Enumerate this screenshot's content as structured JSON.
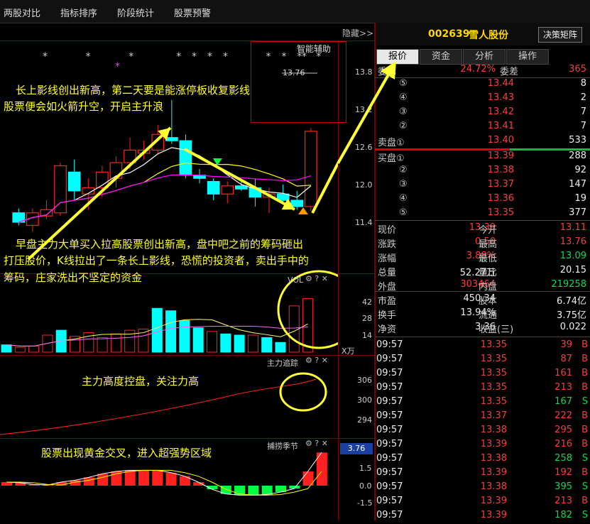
{
  "top_menu": [
    "两股对比",
    "指标排序",
    "阶段统计",
    "股票预警"
  ],
  "hide_label": "隐藏>>",
  "stock": {
    "code": "002639",
    "name": "雪人股份",
    "decision_button": "决策矩阵"
  },
  "tabs": [
    "报价",
    "资金",
    "分析",
    "操作"
  ],
  "aux_label": "智能辅助",
  "aux_price": "13.76",
  "price_axis": [
    "13.8",
    "13.2",
    "12.6",
    "12.0",
    "11.4"
  ],
  "vol_axis": [
    "42",
    "28",
    "14"
  ],
  "vol_unit": "X万",
  "track_axis": [
    "306",
    "300",
    "294"
  ],
  "season_axis": [
    "1.5",
    "0.0",
    "-1.5"
  ],
  "season_value": "3.76",
  "panels": {
    "vol": "VOL",
    "track": "主力追踪",
    "season": "捕捞季节"
  },
  "annotations": {
    "a1_line1": "长上影线创出新高，第二天要是能涨停板收复影线",
    "a1_line2": "股票便会如火箭升空，开启主升浪",
    "a2_line1": "早盘主力大单买入拉高股票创出新高，盘中吧之前的筹码砸出",
    "a2_line2": "打压股价，K线拉出了一条长上影线，恐慌的投资者，卖出手中的",
    "a2_line3": "筹码，庄家洗出不坚定的资金",
    "a3": "主力高度控盘，关注力高",
    "a4": "股票出现黄金交叉，进入超强势区域"
  },
  "quote": {
    "weibi_label": "委比",
    "weibi_value": "24.72%",
    "weicha_label": "委差",
    "weicha_value": "365",
    "sell": [
      {
        "label": "⑤",
        "price": "13.44",
        "vol": "8"
      },
      {
        "label": "④",
        "price": "13.43",
        "vol": "2"
      },
      {
        "label": "③",
        "price": "13.42",
        "vol": "7"
      },
      {
        "label": "②",
        "price": "13.41",
        "vol": "7"
      },
      {
        "label": "卖盘①",
        "price": "13.40",
        "vol": "533"
      }
    ],
    "buy": [
      {
        "label": "买盘①",
        "price": "13.39",
        "vol": "288"
      },
      {
        "label": "②",
        "price": "13.38",
        "vol": "92"
      },
      {
        "label": "③",
        "price": "13.37",
        "vol": "147"
      },
      {
        "label": "④",
        "price": "13.36",
        "vol": "19"
      },
      {
        "label": "⑤",
        "price": "13.35",
        "vol": "377"
      }
    ],
    "stats": [
      {
        "l1": "现价",
        "v1": "13.39",
        "l2": "今开",
        "v2": "13.11"
      },
      {
        "l1": "涨跌",
        "v1": "0.50",
        "l2": "最高",
        "v2": "13.76"
      },
      {
        "l1": "涨幅",
        "v1": "3.88%",
        "l2": "最低",
        "v2": "13.09"
      },
      {
        "l1": "总量",
        "v1": "52.27万",
        "l2": "量比",
        "v2": "20.15"
      },
      {
        "l1": "外盘",
        "v1": "303464",
        "l2": "内盘",
        "v2": "219258"
      }
    ],
    "stats2": [
      {
        "l1": "市盈",
        "v1": "450.34",
        "l2": "股本",
        "v2": "6.74亿"
      },
      {
        "l1": "换手",
        "v1": "13.94%",
        "l2": "流通",
        "v2": "3.75亿"
      },
      {
        "l1": "净资",
        "v1": "3.36",
        "l2": "收益(三)",
        "v2": "0.022"
      }
    ]
  },
  "ticks": [
    {
      "t": "09:57",
      "p": "13.35",
      "v": "39",
      "bs": "B"
    },
    {
      "t": "09:57",
      "p": "13.35",
      "v": "87",
      "bs": "B"
    },
    {
      "t": "09:57",
      "p": "13.35",
      "v": "161",
      "bs": "B"
    },
    {
      "t": "09:57",
      "p": "13.35",
      "v": "213",
      "bs": "B"
    },
    {
      "t": "09:57",
      "p": "13.35",
      "v": "167",
      "bs": "S"
    },
    {
      "t": "09:57",
      "p": "13.37",
      "v": "222",
      "bs": "B"
    },
    {
      "t": "09:57",
      "p": "13.38",
      "v": "295",
      "bs": "B"
    },
    {
      "t": "09:57",
      "p": "13.39",
      "v": "216",
      "bs": "B"
    },
    {
      "t": "09:57",
      "p": "13.38",
      "v": "258",
      "bs": "S"
    },
    {
      "t": "09:57",
      "p": "13.39",
      "v": "192",
      "bs": "B"
    },
    {
      "t": "09:57",
      "p": "13.38",
      "v": "395",
      "bs": "S"
    },
    {
      "t": "09:57",
      "p": "13.39",
      "v": "213",
      "bs": "B"
    },
    {
      "t": "09:57",
      "p": "13.39",
      "v": "182",
      "bs": "S"
    }
  ],
  "colors": {
    "up": "#ff2020",
    "down": "#00ffff",
    "arrow": "#ffff33",
    "divider": "#7a0000"
  },
  "chart_data": {
    "type": "candlestick",
    "ylim": [
      11.2,
      14.0
    ],
    "candles": [
      {
        "o": 11.55,
        "h": 11.62,
        "l": 11.35,
        "c": 11.4
      },
      {
        "o": 11.35,
        "h": 11.62,
        "l": 11.25,
        "c": 11.55
      },
      {
        "o": 11.5,
        "h": 11.75,
        "l": 11.45,
        "c": 11.6
      },
      {
        "o": 11.55,
        "h": 12.35,
        "l": 11.5,
        "c": 12.3
      },
      {
        "o": 12.2,
        "h": 12.4,
        "l": 11.75,
        "c": 11.9
      },
      {
        "o": 11.85,
        "h": 12.1,
        "l": 11.6,
        "c": 11.95
      },
      {
        "o": 11.95,
        "h": 12.3,
        "l": 11.8,
        "c": 12.2
      },
      {
        "o": 12.1,
        "h": 12.45,
        "l": 11.95,
        "c": 12.35
      },
      {
        "o": 12.35,
        "h": 12.75,
        "l": 12.25,
        "c": 12.55
      },
      {
        "o": 12.5,
        "h": 12.7,
        "l": 12.4,
        "c": 12.55
      },
      {
        "o": 12.55,
        "h": 12.95,
        "l": 12.5,
        "c": 12.8
      },
      {
        "o": 12.75,
        "h": 13.35,
        "l": 12.65,
        "c": 12.7
      },
      {
        "o": 12.7,
        "h": 12.8,
        "l": 12.1,
        "c": 12.15
      },
      {
        "o": 12.15,
        "h": 12.25,
        "l": 12.02,
        "c": 12.1
      },
      {
        "o": 12.05,
        "h": 12.1,
        "l": 11.75,
        "c": 11.85
      },
      {
        "o": 11.85,
        "h": 12.05,
        "l": 11.7,
        "c": 11.98
      },
      {
        "o": 11.98,
        "h": 12.05,
        "l": 11.9,
        "c": 11.93
      },
      {
        "o": 11.95,
        "h": 12.1,
        "l": 11.65,
        "c": 11.8
      },
      {
        "o": 11.8,
        "h": 11.95,
        "l": 11.55,
        "c": 11.85
      },
      {
        "o": 11.85,
        "h": 12.0,
        "l": 11.7,
        "c": 11.75
      },
      {
        "o": 11.75,
        "h": 11.9,
        "l": 11.6,
        "c": 11.65
      },
      {
        "o": 11.65,
        "h": 12.9,
        "l": 11.58,
        "c": 12.85
      }
    ],
    "volume": [
      6,
      4,
      5,
      14,
      18,
      13,
      16,
      12,
      15,
      18,
      19,
      36,
      34,
      26,
      20,
      17,
      15,
      14,
      14,
      12,
      8,
      38,
      44
    ],
    "season": [
      0.3,
      0.25,
      0.1,
      0.05,
      0.3,
      0.45,
      0.7,
      1.0,
      1.2,
      1.3,
      1.3,
      1.3,
      1.1,
      0.8,
      0.3,
      -0.3,
      -0.7,
      -0.8,
      -0.8,
      -0.75,
      -0.55,
      -0.25,
      1.2,
      2.8
    ]
  }
}
